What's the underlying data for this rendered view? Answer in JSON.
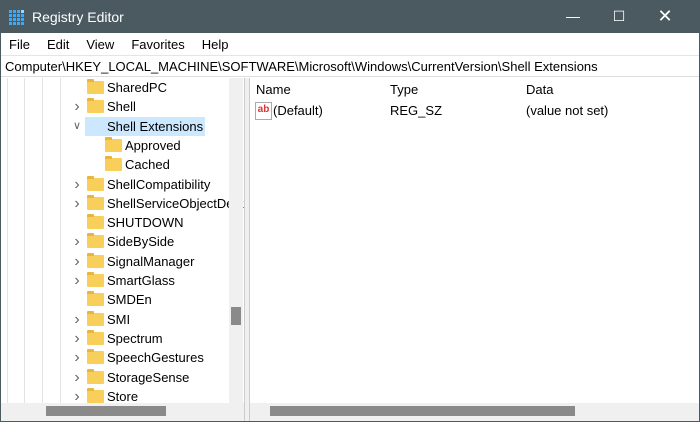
{
  "window": {
    "title": "Registry Editor",
    "accent": "#4b5961"
  },
  "menu": [
    "File",
    "Edit",
    "View",
    "Favorites",
    "Help"
  ],
  "address": "Computer\\HKEY_LOCAL_MACHINE\\SOFTWARE\\Microsoft\\Windows\\CurrentVersion\\Shell Extensions",
  "tree": [
    {
      "label": "SharedPC",
      "indent": 0,
      "expander": "none"
    },
    {
      "label": "Shell",
      "indent": 0,
      "expander": "collapsed"
    },
    {
      "label": "Shell Extensions",
      "indent": 0,
      "expander": "expanded",
      "selected": true
    },
    {
      "label": "Approved",
      "indent": 1,
      "expander": "none"
    },
    {
      "label": "Cached",
      "indent": 1,
      "expander": "none"
    },
    {
      "label": "ShellCompatibility",
      "indent": 0,
      "expander": "collapsed"
    },
    {
      "label": "ShellServiceObjectDelayLoad",
      "indent": 0,
      "expander": "collapsed"
    },
    {
      "label": "SHUTDOWN",
      "indent": 0,
      "expander": "none"
    },
    {
      "label": "SideBySide",
      "indent": 0,
      "expander": "collapsed"
    },
    {
      "label": "SignalManager",
      "indent": 0,
      "expander": "collapsed"
    },
    {
      "label": "SmartGlass",
      "indent": 0,
      "expander": "collapsed"
    },
    {
      "label": "SMDEn",
      "indent": 0,
      "expander": "none"
    },
    {
      "label": "SMI",
      "indent": 0,
      "expander": "collapsed"
    },
    {
      "label": "Spectrum",
      "indent": 0,
      "expander": "collapsed"
    },
    {
      "label": "SpeechGestures",
      "indent": 0,
      "expander": "collapsed"
    },
    {
      "label": "StorageSense",
      "indent": 0,
      "expander": "collapsed"
    },
    {
      "label": "Store",
      "indent": 0,
      "expander": "collapsed"
    }
  ],
  "values": {
    "columns": [
      "Name",
      "Type",
      "Data"
    ],
    "rows": [
      {
        "name": "(Default)",
        "type": "REG_SZ",
        "data": "(value not set)",
        "icon": "string-value-icon"
      }
    ]
  }
}
